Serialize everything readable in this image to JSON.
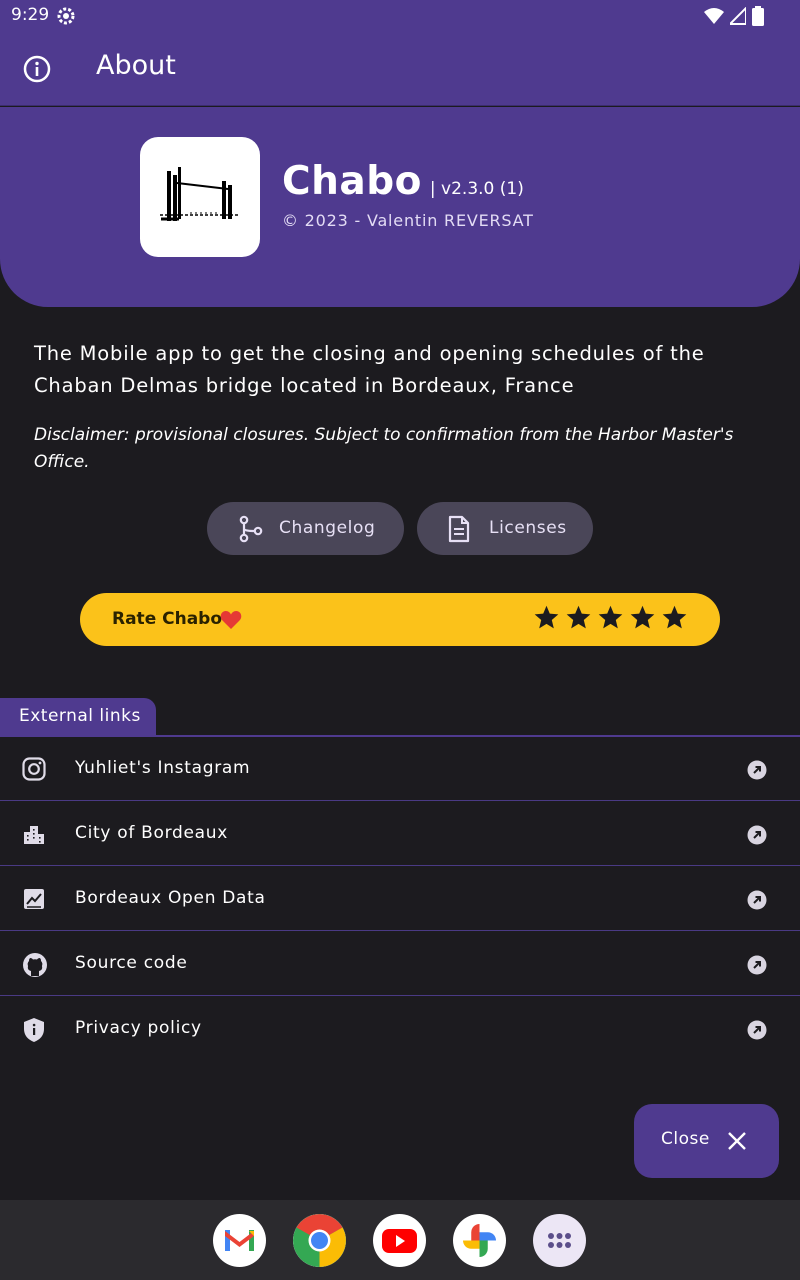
{
  "status_bar": {
    "time": "9:29"
  },
  "app_bar": {
    "title": "About"
  },
  "app_info": {
    "name": "Chabo",
    "version": "| v2.3.0 (1)",
    "copyright": "© 2023 - Valentin REVERSAT"
  },
  "description": "The Mobile app to get the closing and opening schedules of the Chaban Delmas bridge located in Bordeaux, France",
  "disclaimer": "Disclaimer: provisional closures. Subject to confirmation from the Harbor Master's Office.",
  "buttons": {
    "changelog": "Changelog",
    "licenses": "Licenses"
  },
  "rating": {
    "label": "Rate Chabo",
    "stars": 5
  },
  "external_links": {
    "title": "External links",
    "items": [
      {
        "label": "Yuhliet's Instagram",
        "icon": "instagram-icon"
      },
      {
        "label": "City of Bordeaux",
        "icon": "city-icon"
      },
      {
        "label": "Bordeaux Open Data",
        "icon": "chart-icon"
      },
      {
        "label": "Source code",
        "icon": "github-icon"
      },
      {
        "label": "Privacy policy",
        "icon": "shield-icon"
      }
    ]
  },
  "fab": {
    "close_label": "Close"
  },
  "dock": {
    "apps": [
      "gmail-icon",
      "chrome-icon",
      "youtube-icon",
      "photos-icon",
      "app-drawer-icon"
    ]
  },
  "colors": {
    "primary": "#4f3a8f",
    "background": "#1c1b1f",
    "rating": "#fbc21a",
    "chip": "#4a4658"
  }
}
